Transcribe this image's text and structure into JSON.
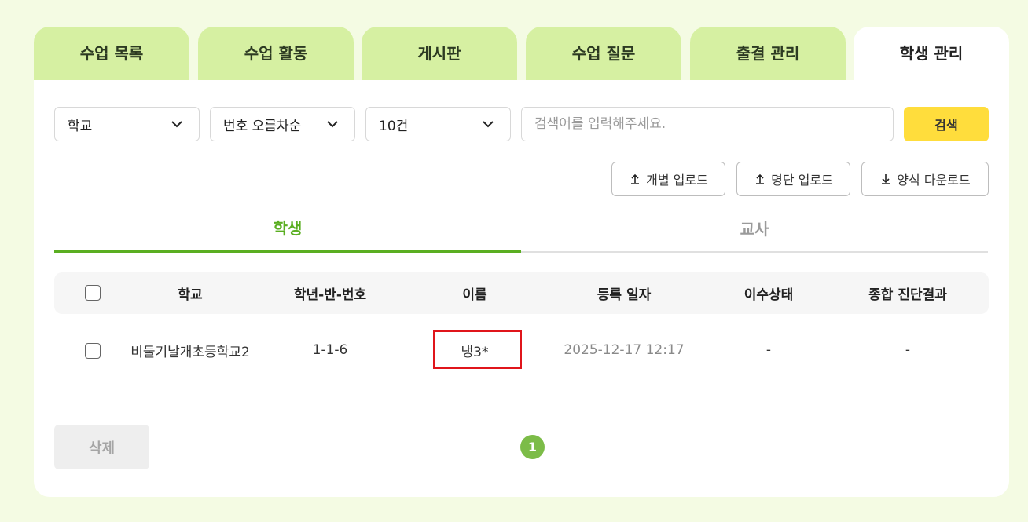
{
  "tabs": [
    {
      "label": "수업 목록",
      "active": false
    },
    {
      "label": "수업 활동",
      "active": false
    },
    {
      "label": "게시판",
      "active": false
    },
    {
      "label": "수업 질문",
      "active": false
    },
    {
      "label": "출결 관리",
      "active": false
    },
    {
      "label": "학생 관리",
      "active": true
    }
  ],
  "filters": {
    "school_select": "학교",
    "sort_select": "번호 오름차순",
    "count_select": "10건",
    "search_placeholder": "검색어를 입력해주세요.",
    "search_value": "",
    "search_button": "검색"
  },
  "actions": {
    "individual_upload": "개별 업로드",
    "roster_upload": "명단 업로드",
    "template_download": "양식 다운로드"
  },
  "subtabs": {
    "student": "학생",
    "teacher": "교사",
    "active": "student"
  },
  "table": {
    "columns": [
      "학교",
      "학년-반-번호",
      "이름",
      "등록 일자",
      "이수상태",
      "종합 진단결과"
    ],
    "rows": [
      {
        "checked": false,
        "school": "비둘기날개초등학교2",
        "grade_class_number": "1-1-6",
        "name": "냉3*",
        "registered_at": "2025-12-17 12:17",
        "completion_status": "-",
        "diagnosis_result": "-"
      }
    ]
  },
  "footer": {
    "delete_button": "삭제",
    "current_page": "1"
  },
  "colors": {
    "background": "#f4fbe3",
    "tab_inactive": "#d6f0a2",
    "accent_green": "#5aae21",
    "search_yellow": "#ffdd3c",
    "highlight_red": "#e0151b",
    "page_green": "#7cbc48"
  }
}
